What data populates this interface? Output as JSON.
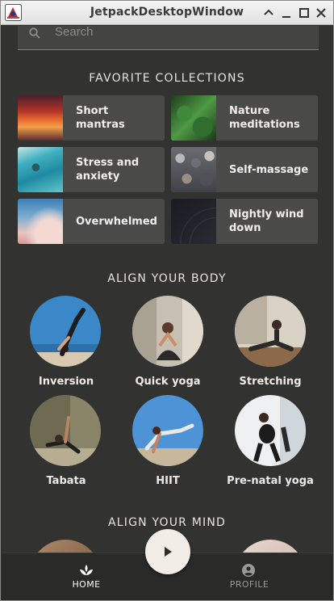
{
  "window": {
    "title": "JetpackDesktopWindow"
  },
  "search": {
    "placeholder": "Search"
  },
  "favorites": {
    "title": "FAVORITE COLLECTIONS",
    "items": [
      {
        "label": "Short mantras"
      },
      {
        "label": "Nature meditations"
      },
      {
        "label": "Stress and anxiety"
      },
      {
        "label": "Self-massage"
      },
      {
        "label": "Overwhelmed"
      },
      {
        "label": "Nightly wind down"
      }
    ]
  },
  "align_body": {
    "title": "ALIGN YOUR BODY",
    "items": [
      {
        "label": "Inversion"
      },
      {
        "label": "Quick yoga"
      },
      {
        "label": "Stretching"
      },
      {
        "label": "Tabata"
      },
      {
        "label": "HIIT"
      },
      {
        "label": "Pre-natal yoga"
      }
    ]
  },
  "align_mind": {
    "title": "ALIGN YOUR MIND"
  },
  "nav": {
    "home": {
      "label": "HOME",
      "icon": "spa-icon",
      "active": true
    },
    "profile": {
      "label": "PROFILE",
      "icon": "account-circle-icon",
      "active": false
    },
    "play": {
      "icon": "play-icon"
    }
  },
  "colors": {
    "background": "#323231",
    "card": "#4a4a48",
    "text": "#f1ede8",
    "fab": "#f1ece6",
    "nav_active": "#ffffff",
    "nav_inactive": "#9a9a98"
  }
}
